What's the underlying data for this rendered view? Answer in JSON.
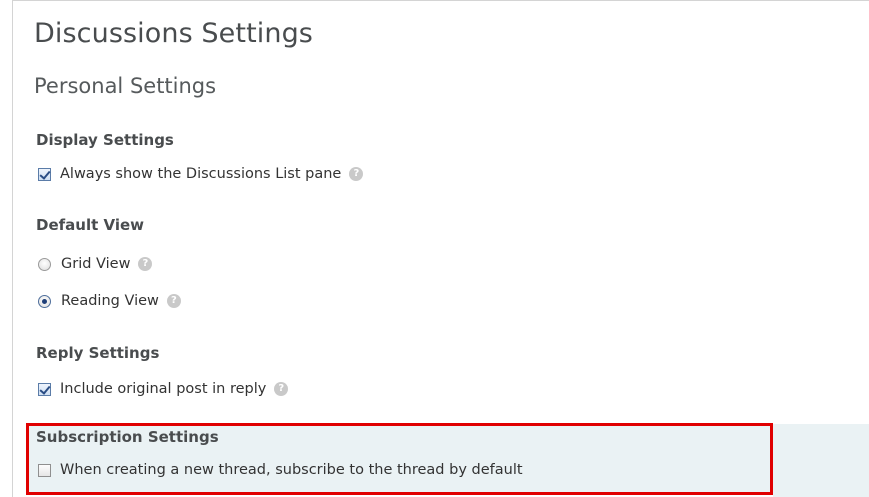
{
  "page": {
    "title": "Discussions Settings",
    "section_title": "Personal Settings"
  },
  "display_settings": {
    "label": "Display Settings",
    "options": [
      {
        "label": "Always show the Discussions List pane",
        "checked": true,
        "help_icon": "help-icon"
      }
    ]
  },
  "default_view": {
    "label": "Default View",
    "options": [
      {
        "label": "Grid View",
        "selected": false,
        "help_icon": "help-icon"
      },
      {
        "label": "Reading View",
        "selected": true,
        "help_icon": "help-icon"
      }
    ]
  },
  "reply_settings": {
    "label": "Reply Settings",
    "options": [
      {
        "label": "Include original post in reply",
        "checked": true,
        "help_icon": "help-icon"
      }
    ]
  },
  "subscription_settings": {
    "label": "Subscription Settings",
    "options": [
      {
        "label": "When creating a new thread, subscribe to the thread by default",
        "checked": false
      }
    ],
    "highlight_color": "#e00000"
  }
}
